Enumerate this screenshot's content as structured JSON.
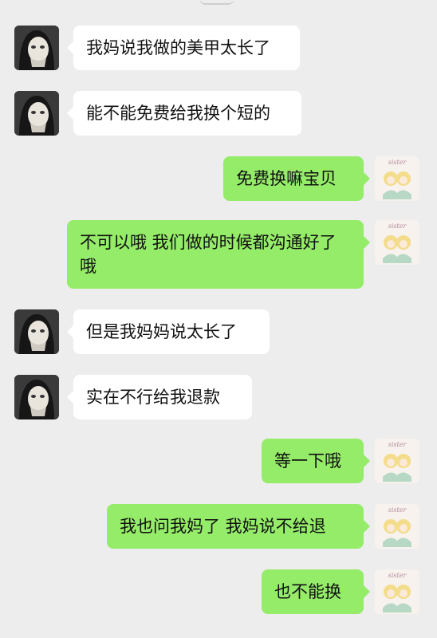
{
  "colors": {
    "background": "#ededed",
    "incoming_bubble": "#ffffff",
    "outgoing_bubble": "#95ec69"
  },
  "avatars": {
    "left_icon": "girl-with-mask-avatar",
    "right_icon": "sister-cartoon-avatar",
    "right_caption": "sister"
  },
  "messages": [
    {
      "side": "in",
      "text": "我妈说我做的美甲太长了"
    },
    {
      "side": "in",
      "text": "能不能免费给我换个短的"
    },
    {
      "side": "out",
      "text": "免费换嘛宝贝"
    },
    {
      "side": "out",
      "text": "不可以哦 我们做的时候都沟通好了哦"
    },
    {
      "side": "in",
      "text": "但是我妈妈说太长了"
    },
    {
      "side": "in",
      "text": "实在不行给我退款"
    },
    {
      "side": "out",
      "text": "等一下哦"
    },
    {
      "side": "out",
      "text": "我也问我妈了 我妈说不给退"
    },
    {
      "side": "out",
      "text": "也不能换"
    }
  ]
}
